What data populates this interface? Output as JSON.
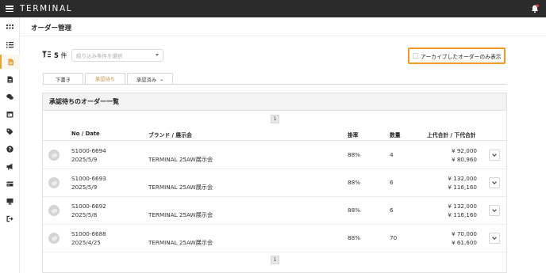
{
  "app": {
    "logo": "TERMINAL"
  },
  "sidebar": {
    "items": [
      {
        "icon": "grid-icon"
      },
      {
        "icon": "list-icon"
      },
      {
        "icon": "order-document-icon",
        "active": true
      },
      {
        "icon": "file-icon"
      },
      {
        "icon": "chat-icon"
      },
      {
        "icon": "calendar-icon"
      },
      {
        "icon": "tag-icon"
      },
      {
        "icon": "help-icon"
      },
      {
        "icon": "megaphone-icon"
      },
      {
        "icon": "card-icon"
      },
      {
        "icon": "monitor-icon"
      },
      {
        "icon": "logout-icon"
      }
    ]
  },
  "page": {
    "title": "オーダー管理"
  },
  "filter": {
    "count_number": "5",
    "count_unit": "件",
    "select_placeholder": "絞り込み条件を選択"
  },
  "archive": {
    "label": "アーカイブしたオーダーのみ表示",
    "checked": false
  },
  "tabs": [
    {
      "label": "下書き"
    },
    {
      "label": "承認待ち",
      "active": true
    },
    {
      "label": "承認済み",
      "chevron": "⌄"
    }
  ],
  "card": {
    "title": "承認待ちのオーダー一覧"
  },
  "pagination": {
    "current": "1"
  },
  "table": {
    "headers": {
      "no_date": "No / Date",
      "brand": "ブランド / 展示会",
      "rate": "掛率",
      "qty": "数量",
      "price": "上代合計 / 下代合計"
    },
    "rows": [
      {
        "no": "S1000-6694",
        "date": "2025/5/9",
        "brand": "TERMINAL 25AW展示会",
        "rate": "88%",
        "qty": "4",
        "retail": "¥ 92,000",
        "wholesale": "¥ 80,960"
      },
      {
        "no": "S1000-6693",
        "date": "2025/5/9",
        "brand": "TERMINAL 25AW展示会",
        "rate": "88%",
        "qty": "6",
        "retail": "¥ 132,000",
        "wholesale": "¥ 116,160"
      },
      {
        "no": "S1000-6692",
        "date": "2025/5/8",
        "brand": "TERMINAL 25AW展示会",
        "rate": "88%",
        "qty": "6",
        "retail": "¥ 132,000",
        "wholesale": "¥ 116,160"
      },
      {
        "no": "S1000-6688",
        "date": "2025/4/25",
        "brand": "TERMINAL 25AW展示会",
        "rate": "88%",
        "qty": "70",
        "retail": "¥ 70,000",
        "wholesale": "¥ 61,600"
      }
    ]
  },
  "colors": {
    "accent": "#f39a25",
    "tab_active": "#c69344",
    "topbar": "#2b2b2b",
    "badge": "#e53935"
  }
}
